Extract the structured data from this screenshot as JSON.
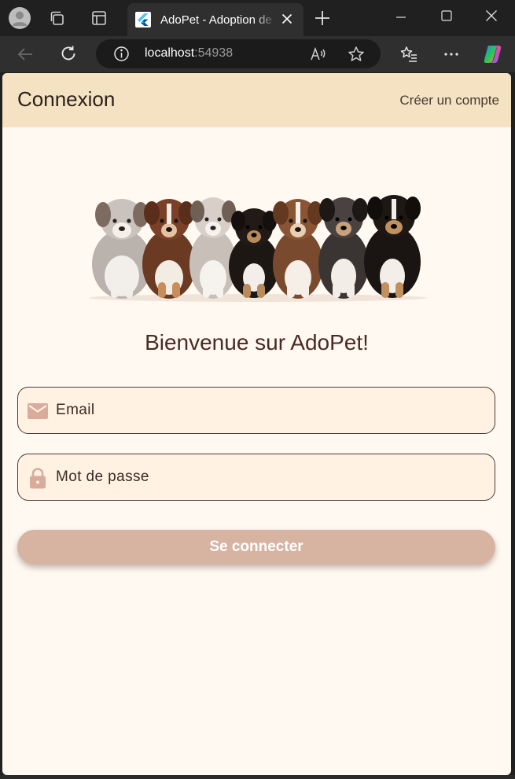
{
  "browser": {
    "tab_title": "AdoPet - Adoption de",
    "url_host": "localhost",
    "url_port": ":54938",
    "icons": [
      "profile-icon",
      "workspaces-icon",
      "tab-actions-icon",
      "flutter-favicon",
      "tab-close-icon",
      "new-tab-icon",
      "minimize-icon",
      "maximize-icon",
      "window-close-icon",
      "back-icon",
      "refresh-icon",
      "site-info-icon",
      "read-aloud-icon",
      "favorite-star-icon",
      "favorites-list-icon",
      "more-menu-icon",
      "copilot-icon"
    ]
  },
  "appbar": {
    "title": "Connexion",
    "create_account": "Créer un compte",
    "background": "#f4e2c3"
  },
  "welcome": "Bienvenue sur AdoPet!",
  "form": {
    "email_placeholder": "Email",
    "password_placeholder": "Mot de passe",
    "submit_label": "Se connecter",
    "icon_color": "#d9ab9b",
    "button_color": "#d7b3a2"
  },
  "hero_image": "puppies-row"
}
